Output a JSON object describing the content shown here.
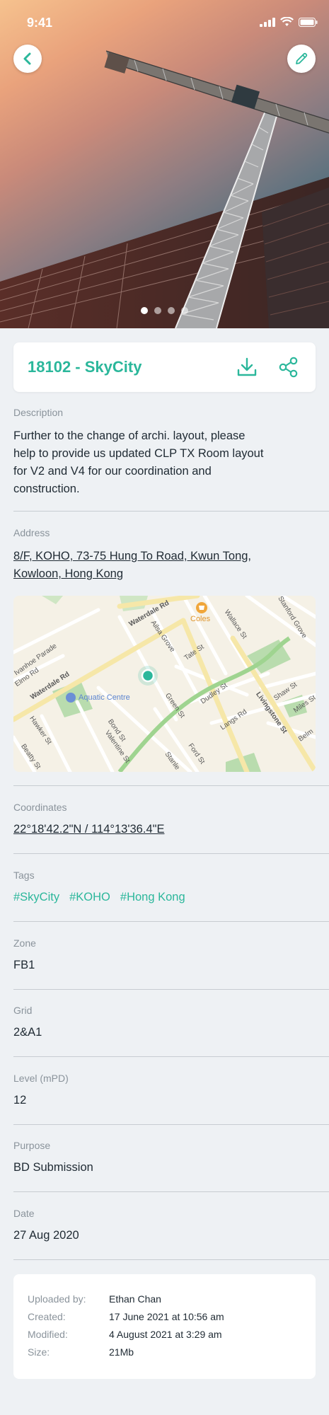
{
  "status_bar": {
    "time": "9:41"
  },
  "hero": {
    "image_subject": "construction crane against sky",
    "page_count": 4,
    "active_page": 1
  },
  "header_buttons": {
    "back_icon": "chevron-left-icon",
    "edit_icon": "pencil-icon"
  },
  "title_card": {
    "title": "18102 - SkyCity",
    "download_icon": "download-icon",
    "share_icon": "share-icon"
  },
  "description": {
    "label": "Description",
    "lines": [
      "Further to the change of archi. layout, please",
      "help to provide us updated CLP TX Room layout",
      "for V2 and V4 for our coordination and",
      "construction."
    ]
  },
  "address": {
    "label": "Address",
    "line1": "8/F, KOHO, 73-75 Hung To Road, Kwun Tong,",
    "line2": "Kowloon, Hong Kong"
  },
  "map": {
    "labels": {
      "waterdale_rd_1": "Waterdale Rd",
      "waterdale_rd_2": "Waterdale Rd",
      "ailsa_grove": "Ailsa Grove",
      "tate_st": "Tate St",
      "wallace_st": "Wallace St",
      "stanford_grove": "Stanford Grove",
      "elmo_rd": "Elmo Rd",
      "ivanhoe_parade": "Ivanhoe Parade",
      "green_st": "Green St",
      "dudley_st": "Dudley St",
      "livingstone_st": "Livingstone St",
      "shaw_st": "Shaw St",
      "miles_st": "Miles St",
      "bond_st": "Bond St",
      "langs_rd": "Langs Rd",
      "hawker_st": "Hawker St",
      "valentine_st": "Valentine St",
      "ford_st": "Ford St",
      "beatty_st": "Beatty St",
      "stanley": "Stanle",
      "belmore": "Belm"
    },
    "poi_coles": "Coles",
    "poi_aquatic": "Aquatic Centre",
    "colors": {
      "road": "#ffffff",
      "major_road": "#f6e7a8",
      "park": "#b9dcae",
      "pin": "#2bb79b",
      "land": "#f5f1e6"
    }
  },
  "coordinates": {
    "label": "Coordinates",
    "value": "22°18'42.2\"N / 114°13'36.4\"E"
  },
  "tags": {
    "label": "Tags",
    "items": [
      "#SkyCity",
      "#KOHO",
      "#Hong Kong"
    ]
  },
  "zone": {
    "label": "Zone",
    "value": "FB1"
  },
  "grid": {
    "label": "Grid",
    "value": "2&A1"
  },
  "level": {
    "label": "Level (mPD)",
    "value": "12"
  },
  "purpose": {
    "label": "Purpose",
    "value": "BD Submission"
  },
  "date": {
    "label": "Date",
    "value": "27 Aug 2020"
  },
  "info": {
    "uploaded_by_label": "Uploaded by:",
    "uploaded_by": "Ethan Chan",
    "created_label": "Created:",
    "created": "17 June 2021 at 10:56 am",
    "modified_label": "Modified:",
    "modified": "4 August 2021 at 3:29 am",
    "size_label": "Size:",
    "size": "21Mb"
  },
  "colors": {
    "accent": "#2bb79b",
    "background": "#eef1f4",
    "muted": "#8a939b",
    "text": "#1f2a33"
  }
}
